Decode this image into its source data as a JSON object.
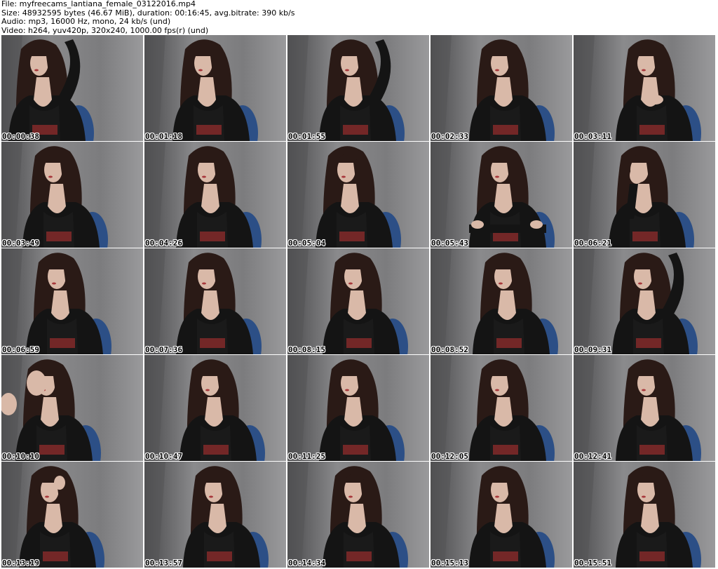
{
  "header": {
    "file": "File: myfreecams_lantiana_female_03122016.mp4",
    "size": "Size: 48932595 bytes (46.67 MiB), duration: 00:16:45, avg.bitrate: 390 kb/s",
    "audio": "Audio: mp3, 16000 Hz, mono, 24 kb/s (und)",
    "video": "Video: h264, yuv420p, 320x240, 1000.00 fps(r) (und)"
  },
  "colors": {
    "wall_light": "#8a8a8c",
    "wall_dark": "#4a4a4c",
    "hair": "#2a1a16",
    "skin": "#d9b9a8",
    "cardigan": "#141414",
    "chair": "#2c4f86",
    "print_red": "#8a2a2a"
  },
  "thumbnails": [
    {
      "time": "00:00:38",
      "pose": "arm-up"
    },
    {
      "time": "00:01:18",
      "pose": "hair-down"
    },
    {
      "time": "00:01:55",
      "pose": "arm-up"
    },
    {
      "time": "00:02:33",
      "pose": "neutral"
    },
    {
      "time": "00:03:11",
      "pose": "hand-chest"
    },
    {
      "time": "00:03:49",
      "pose": "neutral"
    },
    {
      "time": "00:04:26",
      "pose": "neutral"
    },
    {
      "time": "00:05:04",
      "pose": "neutral"
    },
    {
      "time": "00:05:43",
      "pose": "arms-crossed"
    },
    {
      "time": "00:06:21",
      "pose": "hand-face"
    },
    {
      "time": "00:06:59",
      "pose": "neutral"
    },
    {
      "time": "00:07:36",
      "pose": "neutral"
    },
    {
      "time": "00:08:15",
      "pose": "neutral"
    },
    {
      "time": "00:08:52",
      "pose": "neutral"
    },
    {
      "time": "00:09:31",
      "pose": "arm-up"
    },
    {
      "time": "00:10:10",
      "pose": "waving"
    },
    {
      "time": "00:10:47",
      "pose": "neutral"
    },
    {
      "time": "00:11:25",
      "pose": "neutral"
    },
    {
      "time": "00:12:05",
      "pose": "neutral"
    },
    {
      "time": "00:12:41",
      "pose": "neutral"
    },
    {
      "time": "00:13:19",
      "pose": "hand-hair"
    },
    {
      "time": "00:13:57",
      "pose": "neutral"
    },
    {
      "time": "00:14:34",
      "pose": "neutral"
    },
    {
      "time": "00:15:13",
      "pose": "neutral"
    },
    {
      "time": "00:15:51",
      "pose": "neutral"
    }
  ]
}
